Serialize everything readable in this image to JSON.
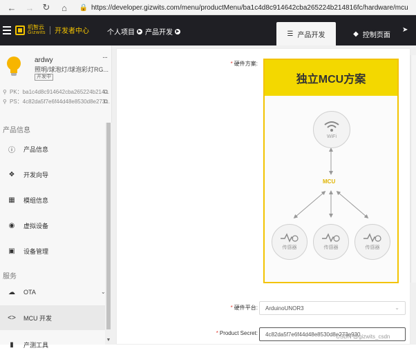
{
  "browser": {
    "back_icon": "back-arrow-icon",
    "forward_icon": "forward-arrow-icon",
    "reload_icon": "reload-icon",
    "home_icon": "home-icon",
    "url": "https://developer.gizwits.com/menu/productMenu/ba1c4d8c914642cba265224b214816fc/hardware/mcu"
  },
  "header": {
    "logo_cn": "机智云",
    "logo_en": "Gizwits",
    "logo_dev": "开发者中心",
    "crumb1": "个人项目",
    "crumb2": "产品开发",
    "tab_active": "产品开发",
    "tab2": "控制页面"
  },
  "product": {
    "name": "ardwy",
    "desc": "照明/球泡灯/球泡彩灯RG...",
    "badge": "开发中",
    "pk_label": "PK：",
    "pk": "ba1c4d8c914642cba265224b214...",
    "ps_label": "PS：",
    "ps": "4c82da5f7e6f44d48e8530d8e273..."
  },
  "sidebar": {
    "section1": "产品信息",
    "section2": "服务",
    "items": [
      {
        "label": "产品信息",
        "icon": "info-icon"
      },
      {
        "label": "开发向导",
        "icon": "signpost-icon"
      },
      {
        "label": "模组信息",
        "icon": "grid-icon"
      },
      {
        "label": "虚拟设备",
        "icon": "globe-icon"
      },
      {
        "label": "设备管理",
        "icon": "device-icon"
      },
      {
        "label": "OTA",
        "icon": "cloud-upload-icon"
      },
      {
        "label": "MCU 开发",
        "icon": "code-icon"
      },
      {
        "label": "产测工具",
        "icon": "tool-icon"
      }
    ]
  },
  "form": {
    "hw_scheme_label": "硬件方案:",
    "mcu_title": "独立MCU方案",
    "wifi_label": "WiFi",
    "mcu_label": "MCU",
    "sensor_label": "传感器",
    "platform_label": "硬件平台:",
    "platform_value": "ArduinoUNOR3",
    "secret_label": "Product Secret:",
    "secret_value": "4c82da5f7e6f44d48e8530d8e273e930"
  },
  "watermark": "CSDN @gizwits_csdn",
  "colors": {
    "header_bg": "#1f1f24",
    "accent_yellow": "#f3d800",
    "required": "#e03e36"
  }
}
